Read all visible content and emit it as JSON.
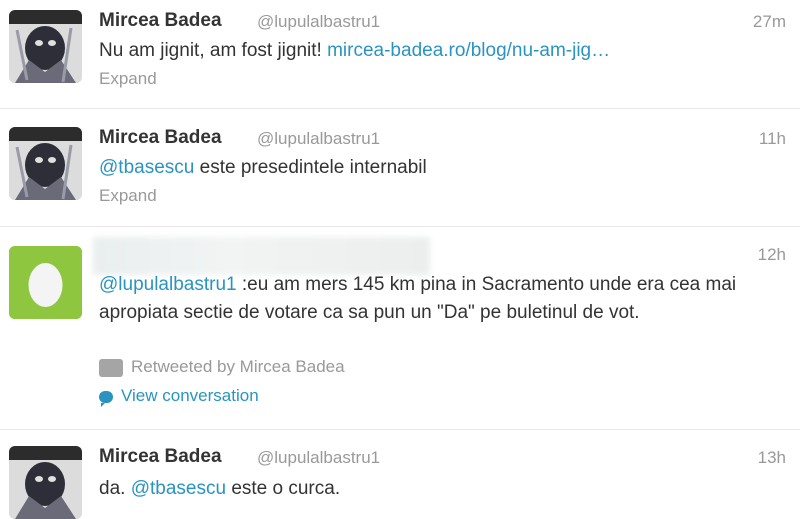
{
  "tweets": [
    {
      "name": "Mircea Badea",
      "handle": "@lupulalbastru1",
      "time": "27m",
      "text_before": "Nu am jignit, am fost jignit! ",
      "link": "mircea-badea.ro/blog/nu-am-jig…",
      "expand": "Expand"
    },
    {
      "name": "Mircea Badea",
      "handle": "@lupulalbastru1",
      "time": "11h",
      "mention": "@tbasescu",
      "text_after": " este presedintele internabil",
      "expand": "Expand"
    },
    {
      "time": "12h",
      "mention": "@lupulalbastru1",
      "text_after": " :eu am mers 145 km pina in Sacramento unde era cea mai apropiata sectie de votare ca sa pun un \"Da\" pe buletinul de vot.",
      "retweeted_by": "Retweeted by Mircea Badea",
      "view_conversation": "View conversation"
    },
    {
      "name": "Mircea Badea",
      "handle": "@lupulalbastru1",
      "time": "13h",
      "text_before": "da. ",
      "mention": "@tbasescu",
      "text_after": " este o curca."
    }
  ],
  "colors": {
    "link": "#2a94c1",
    "muted": "#999999",
    "text": "#333333",
    "egg_bg": "#8ec640"
  },
  "icons": [
    "avatar-image",
    "egg-avatar",
    "retweet-icon",
    "speech-bubble-icon"
  ]
}
